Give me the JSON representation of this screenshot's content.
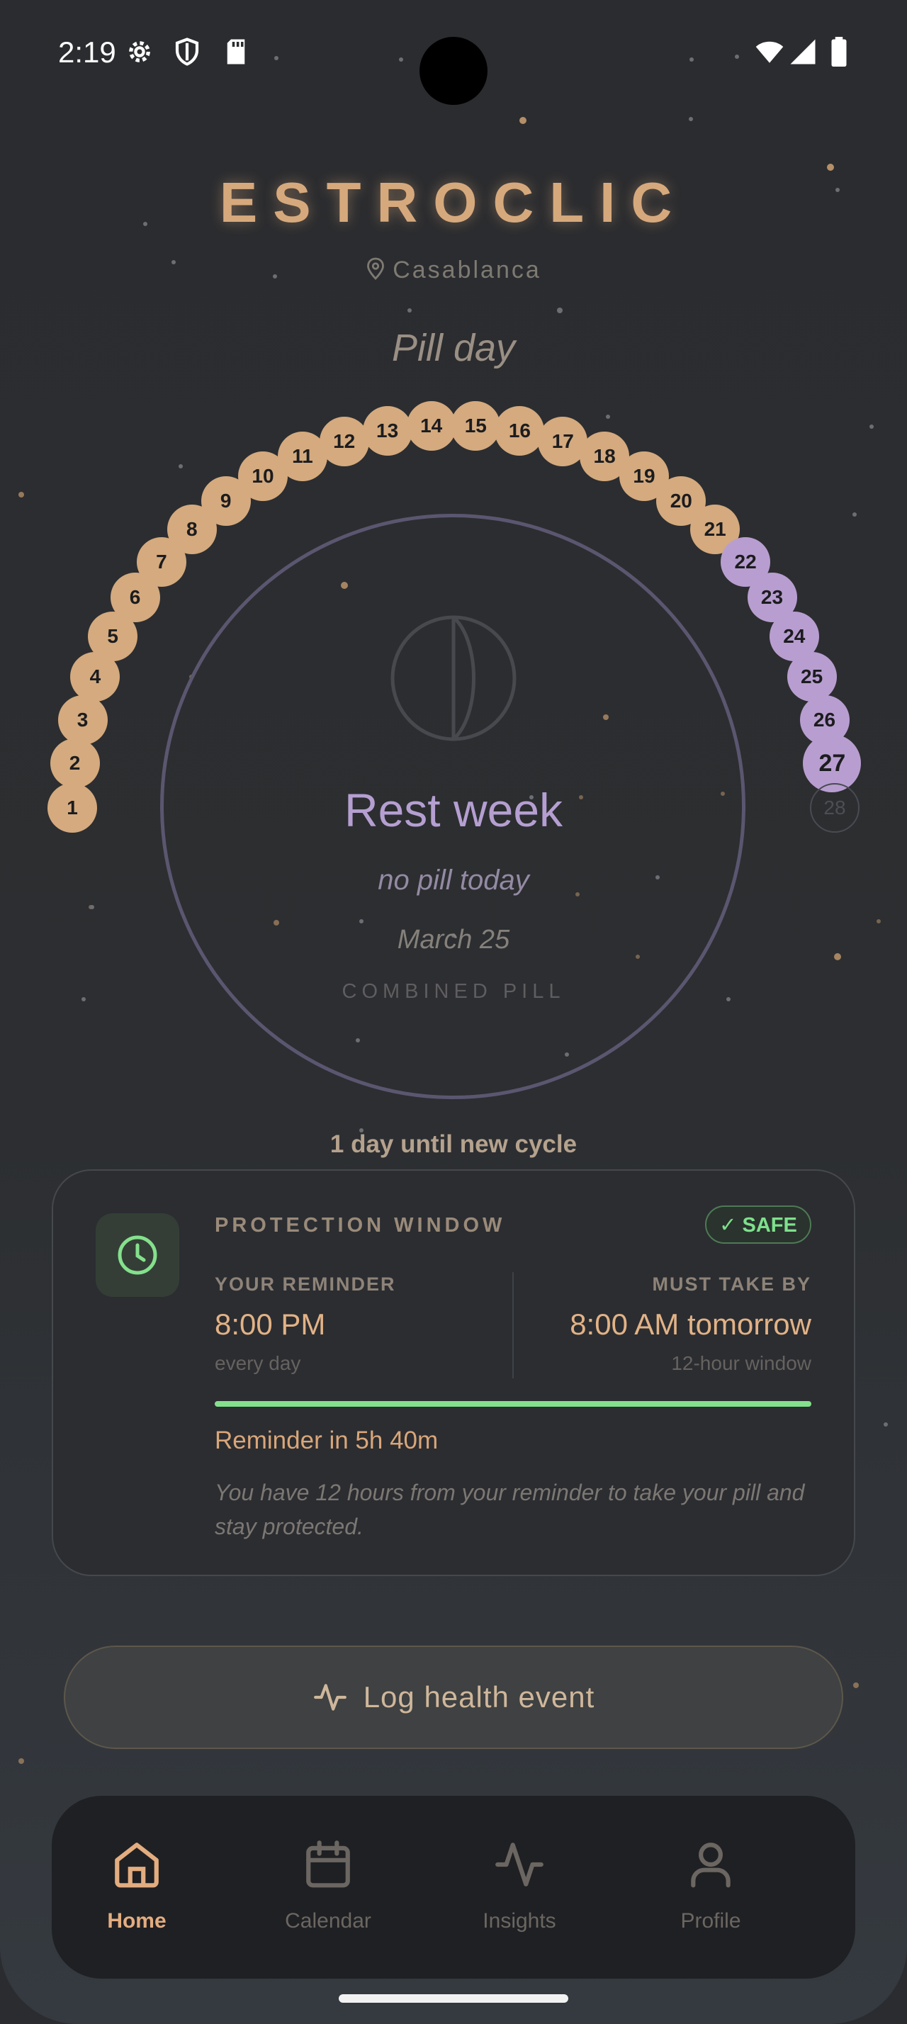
{
  "status_bar": {
    "time": "2:19"
  },
  "header": {
    "title": "ESTROCLIC",
    "location": "Casablanca",
    "pill_day_label": "Pill day"
  },
  "pill_strip": {
    "total_days": 28,
    "current_day": 27,
    "active_days": [
      "1",
      "2",
      "3",
      "4",
      "5",
      "6",
      "7",
      "8",
      "9",
      "10",
      "11",
      "12",
      "13",
      "14",
      "15",
      "16",
      "17",
      "18",
      "19",
      "20",
      "21"
    ],
    "rest_days": [
      "22",
      "23",
      "24",
      "25",
      "26",
      "27"
    ],
    "upcoming_days": [
      "28"
    ],
    "colors": {
      "active": "#d4aa7e",
      "rest": "#b89ed0",
      "upcoming": "#4a4b52"
    }
  },
  "status_circle": {
    "title": "Rest week",
    "subtitle": "no pill today",
    "date": "March 25",
    "pill_type": "COMBINED PILL",
    "icon": "moon-phase-icon"
  },
  "countdown": "1 day until new cycle",
  "protection_card": {
    "title": "PROTECTION WINDOW",
    "badge": "✓ SAFE",
    "icon": "clock-icon",
    "reminder_label": "YOUR REMINDER",
    "reminder_time": "8:00 PM",
    "reminder_freq": "every day",
    "deadline_label": "MUST TAKE BY",
    "deadline_time": "8:00 AM tomorrow",
    "window": "12-hour window",
    "progress_fraction": 1.0,
    "reminder_in": "Reminder in 5h 40m",
    "description": "You have 12 hours from your reminder to take your pill and stay protected.",
    "colors": {
      "safe": "#7ee08c",
      "accent": "#e2b286"
    }
  },
  "log_button": {
    "label": "Log health event",
    "icon": "activity-icon"
  },
  "nav": {
    "items": [
      {
        "label": "Home",
        "icon": "home-icon",
        "active": true
      },
      {
        "label": "Calendar",
        "icon": "calendar-icon",
        "active": false
      },
      {
        "label": "Insights",
        "icon": "activity-icon",
        "active": false
      },
      {
        "label": "Profile",
        "icon": "person-icon",
        "active": false
      }
    ]
  }
}
